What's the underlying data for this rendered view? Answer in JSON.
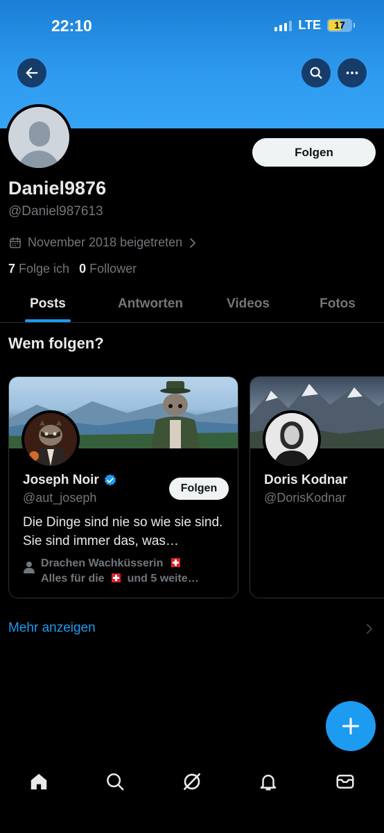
{
  "status_bar": {
    "time": "22:10",
    "network": "LTE",
    "battery": "17"
  },
  "header": {
    "back_icon": "arrow-left-icon",
    "search_icon": "search-icon",
    "more_icon": "more-horizontal-icon",
    "banner_color": "#2f9bf0"
  },
  "profile": {
    "name": "Daniel9876",
    "handle": "@Daniel987613",
    "joined": "November 2018 beigetreten",
    "following_count": "7",
    "following_label": "Folge ich",
    "followers_count": "0",
    "followers_label": "Follower",
    "follow_label": "Folgen"
  },
  "tabs": [
    {
      "label": "Posts",
      "active": true
    },
    {
      "label": "Antworten",
      "active": false
    },
    {
      "label": "Videos",
      "active": false
    },
    {
      "label": "Fotos",
      "active": false
    }
  ],
  "suggestions": {
    "title": "Wem folgen?",
    "cards": [
      {
        "name": "Joseph Noir",
        "verified": true,
        "handle": "@aut_joseph",
        "follow_label": "Folgen",
        "bio": "Die Dinge sind nie so wie sie sind. Sie sind immer das, was…",
        "followed_by_line1": "Drachen Wachküsserin",
        "followed_by_line2_a": "Alles für die",
        "followed_by_line2_b": "und 5 weite…"
      },
      {
        "name": "Doris Kodnar",
        "handle": "@DorisKodnar"
      }
    ],
    "more_label": "Mehr anzeigen"
  },
  "fab_icon": "plus-icon",
  "bottom_nav": [
    {
      "icon": "home-icon"
    },
    {
      "icon": "search-icon"
    },
    {
      "icon": "grok-icon"
    },
    {
      "icon": "bell-icon"
    },
    {
      "icon": "mail-icon"
    }
  ],
  "colors": {
    "accent": "#1d9bf0",
    "muted": "#71767b",
    "text": "#e7e9ea"
  }
}
